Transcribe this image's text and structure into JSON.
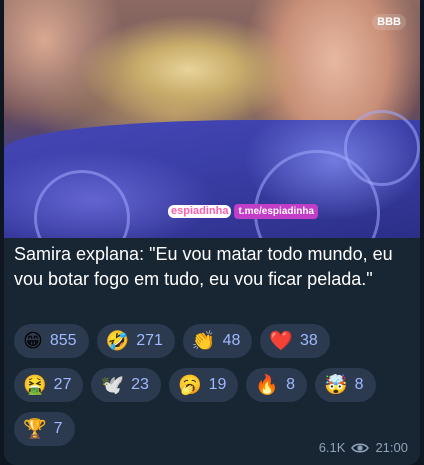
{
  "image": {
    "watermark_logo": "espiadinha",
    "watermark_url": "t.me/espiadinha",
    "corner_badge": "BBB"
  },
  "message": {
    "text": "Samira explana: \"Eu vou matar todo mundo, eu vou botar fogo em tudo, eu vou ficar pelada.\""
  },
  "reactions": [
    {
      "emoji": "😁",
      "icon": "grin-icon",
      "count": "855"
    },
    {
      "emoji": "🤣",
      "icon": "rofl-icon",
      "count": "271"
    },
    {
      "emoji": "👏",
      "icon": "clap-icon",
      "count": "48"
    },
    {
      "emoji": "❤️",
      "icon": "heart-icon",
      "count": "38"
    },
    {
      "emoji": "🤮",
      "icon": "vomit-icon",
      "count": "27"
    },
    {
      "emoji": "🕊️",
      "icon": "dove-icon",
      "count": "23"
    },
    {
      "emoji": "🥱",
      "icon": "yawn-icon",
      "count": "19"
    },
    {
      "emoji": "🔥",
      "icon": "fire-icon",
      "count": "8"
    },
    {
      "emoji": "🤯",
      "icon": "mind-blown-icon",
      "count": "8"
    },
    {
      "emoji": "🏆",
      "icon": "trophy-icon",
      "count": "7"
    }
  ],
  "meta": {
    "views": "6.1K",
    "time": "21:00"
  },
  "colors": {
    "bubble_bg": "#182533",
    "chip_bg": "#2b3a4e",
    "count_text": "#9fb8ff"
  }
}
